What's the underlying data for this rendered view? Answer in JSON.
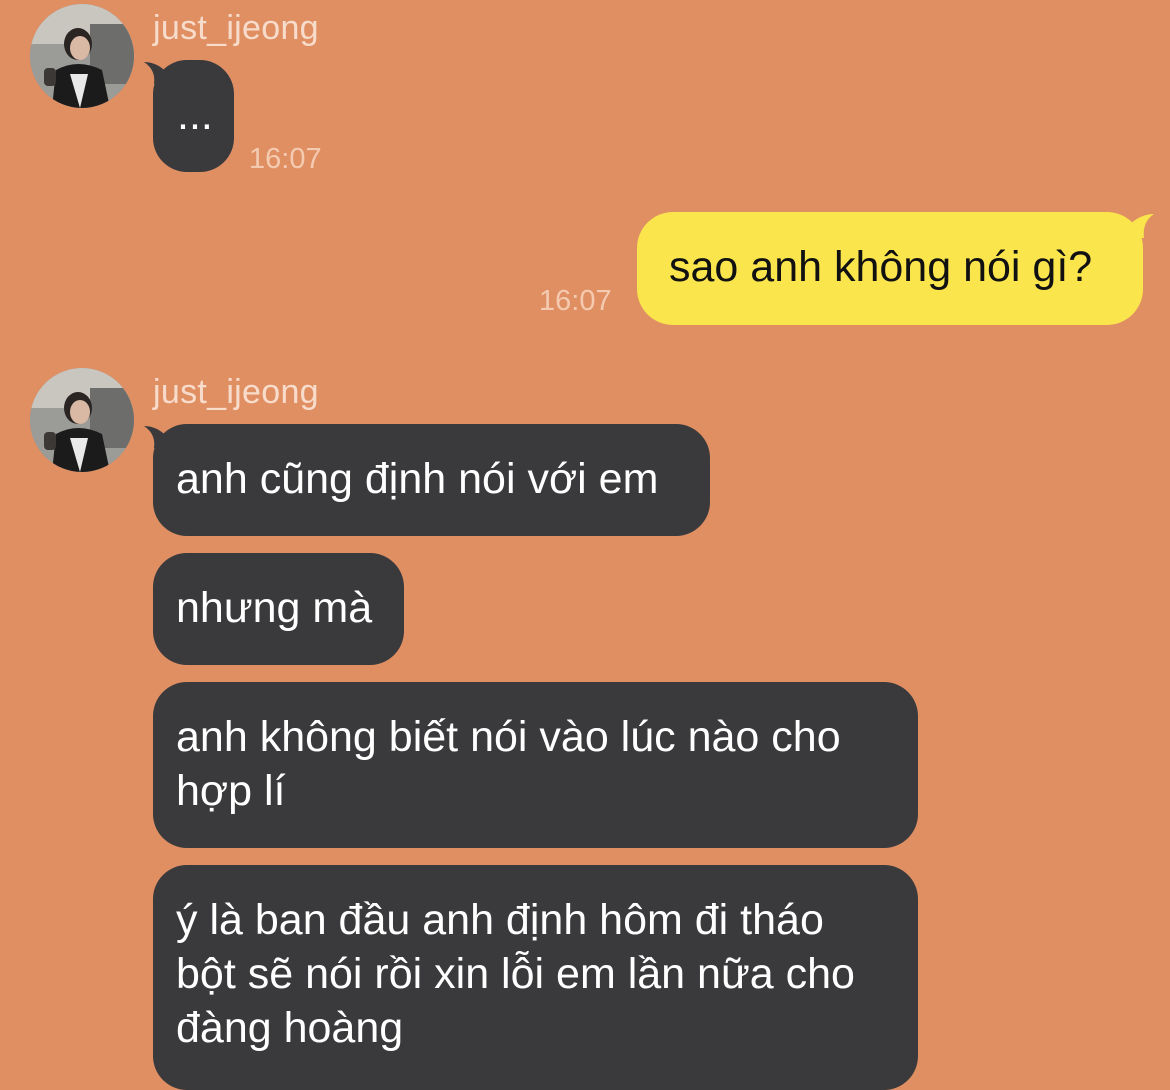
{
  "theme": {
    "background": "#e08f63",
    "incoming_bubble": "#3a3a3c",
    "outgoing_bubble": "#fae54c"
  },
  "messages": [
    {
      "direction": "incoming",
      "sender": "just_ijeong",
      "avatar_icon": "user-photo-avatar",
      "text": "...",
      "time": "16:07"
    },
    {
      "direction": "outgoing",
      "text": "sao anh không nói gì?",
      "time": "16:07"
    },
    {
      "direction": "incoming",
      "sender": "just_ijeong",
      "avatar_icon": "user-photo-avatar",
      "text": "anh cũng định nói với em"
    },
    {
      "direction": "incoming",
      "text": "nhưng mà"
    },
    {
      "direction": "incoming",
      "text": "anh không biết nói vào lúc nào cho\nhợp lí"
    },
    {
      "direction": "incoming",
      "text": "ý là ban đầu anh định hôm đi tháo\nbột sẽ nói rồi xin lỗi em lần nữa cho\nđàng hoàng"
    }
  ]
}
